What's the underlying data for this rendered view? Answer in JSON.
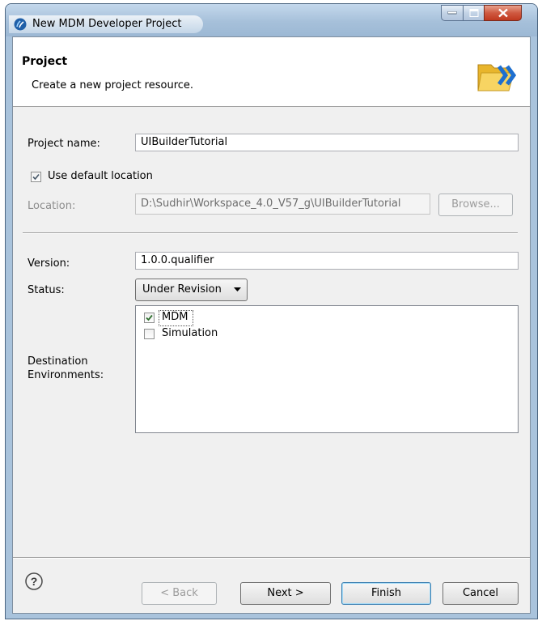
{
  "window": {
    "title": "New MDM Developer Project"
  },
  "header": {
    "title": "Project",
    "description": "Create a new project resource.",
    "icon": "folder-wizard-icon"
  },
  "form": {
    "project_name_label": "Project name:",
    "project_name_value": "UIBuilderTutorial",
    "use_default_location_label": "Use default location",
    "use_default_location_checked": true,
    "location_label": "Location:",
    "location_value": "D:\\Sudhir\\Workspace_4.0_V57_g\\UIBuilderTutorial",
    "browse_label": "Browse...",
    "version_label": "Version:",
    "version_value": "1.0.0.qualifier",
    "status_label": "Status:",
    "status_value": "Under Revision",
    "destination_label_line1": "Destination",
    "destination_label_line2": "Environments:",
    "environments": [
      {
        "label": "MDM",
        "checked": true
      },
      {
        "label": "Simulation",
        "checked": false
      }
    ]
  },
  "footer": {
    "help_icon": "help-icon",
    "back_label": "< Back",
    "next_label": "Next >",
    "finish_label": "Finish",
    "cancel_label": "Cancel"
  },
  "colors": {
    "titlebar": "#a6c0da",
    "dialog_bg": "#f0f0f0",
    "close_button": "#c0381f",
    "default_button_border": "#3c7fb1"
  }
}
